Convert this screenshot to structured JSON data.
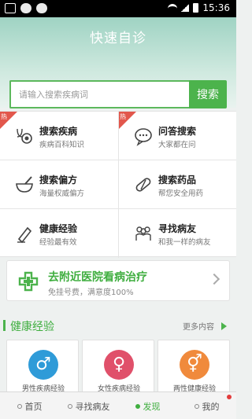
{
  "status_bar": {
    "time": "15:36"
  },
  "header": {
    "title": "快速自诊"
  },
  "search": {
    "placeholder": "请输入搜索疾病词",
    "button_label": "搜索"
  },
  "hot_badge": "热",
  "grid": [
    {
      "title": "搜索疾病",
      "subtitle": "疾病百科知识",
      "icon": "stethoscope-icon",
      "hot": true
    },
    {
      "title": "问答搜索",
      "subtitle": "大家都在问",
      "icon": "speech-bubble-icon",
      "hot": true
    },
    {
      "title": "搜索偏方",
      "subtitle": "海量权威偏方",
      "icon": "mortar-icon",
      "hot": false
    },
    {
      "title": "搜索药品",
      "subtitle": "帮您安全用药",
      "icon": "pill-icon",
      "hot": false
    },
    {
      "title": "健康经验",
      "subtitle": "经验最有效",
      "icon": "pen-icon",
      "hot": false
    },
    {
      "title": "寻找病友",
      "subtitle": "和我一样的病友",
      "icon": "people-icon",
      "hot": false
    }
  ],
  "nearby": {
    "title": "去附近医院看病治疗",
    "subtitle": "免挂号费，满意度100%"
  },
  "section": {
    "title": "健康经验",
    "more": "更多内容"
  },
  "cards": [
    {
      "symbol": "♂",
      "label": "男性疾病经验",
      "color": "#2f9bd8"
    },
    {
      "symbol": "♀",
      "label": "女性疾病经验",
      "color": "#e0506a"
    },
    {
      "symbol": "⚥",
      "label": "两性健康经验",
      "color": "#f08a3c"
    }
  ],
  "tabs": [
    "首页",
    "寻找病友",
    "发现",
    "我的"
  ],
  "colors": {
    "accent": "#4cb34c",
    "hot": "#e2574c"
  }
}
